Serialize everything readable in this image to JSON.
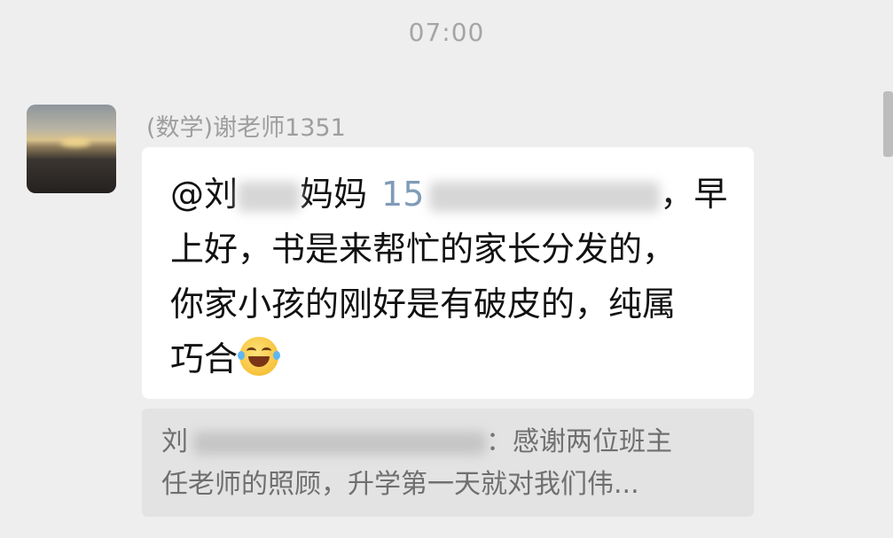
{
  "timestamp": "07:00",
  "message": {
    "sender": "(数学)谢老师1351",
    "line1_a": "@刘",
    "line1_b": "妈妈",
    "line1_c": "15",
    "line1_d": "，早",
    "line2": "上好，书是来帮忙的家长分发的，",
    "line3": "你家小孩的刚好是有破皮的，纯属",
    "line4": "巧合",
    "emoji": "laughing-tears-emoji"
  },
  "quote": {
    "line1_a": "刘",
    "line1_b": "：感谢两位班主",
    "line2": "任老师的照顾，升学第一天就对我们伟..."
  }
}
